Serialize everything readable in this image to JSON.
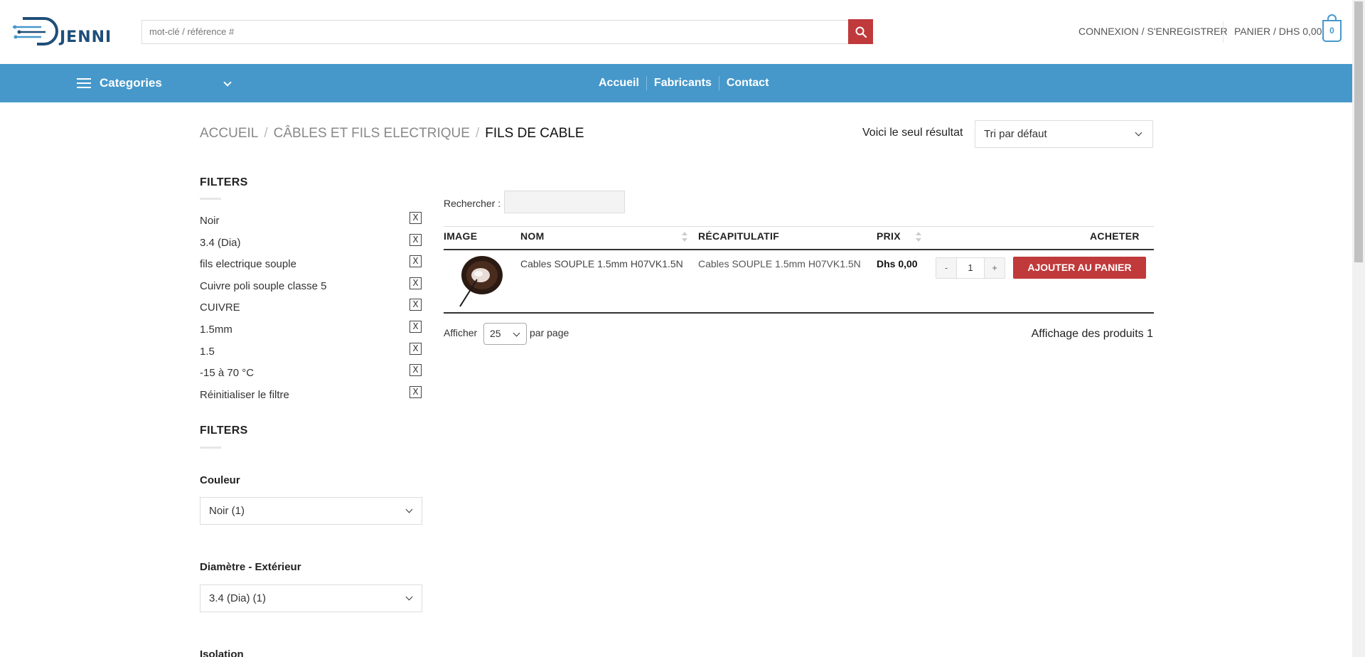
{
  "header": {
    "logo_text": "JENNI",
    "search_placeholder": "mot-clé / référence #",
    "login_label": "CONNEXION / S'ENREGISTRER",
    "cart_label": "PANIER / DHS 0,00",
    "cart_count": "0"
  },
  "nav": {
    "categories_label": "Categories",
    "links": [
      "Accueil",
      "Fabricants",
      "Contact"
    ]
  },
  "breadcrumb": {
    "items": [
      "ACCUEIL",
      "CÂBLES ET FILS ELECTRIQUE",
      "FILS DE CABLE"
    ],
    "separator": "/"
  },
  "results": {
    "count_text": "Voici le seul résultat",
    "sort_value": "Tri par défaut"
  },
  "sidebar": {
    "active_filters_title": "FILTERS",
    "active_filters": [
      "Noir",
      "3.4 (Dia)",
      "fils electrique souple",
      "Cuivre poli souple classe 5",
      "CUIVRE",
      "1.5mm",
      "1.5",
      "-15 à 70 °C",
      "Réinitialiser le filtre"
    ],
    "remove_glyph": "X",
    "filters_title": "FILTERS",
    "attributes": [
      {
        "label": "Couleur",
        "value": "Noir (1)"
      },
      {
        "label": "Diamètre - Extérieur",
        "value": "3.4 (Dia) (1)"
      },
      {
        "label": "Isolation"
      }
    ]
  },
  "table": {
    "search_label": "Rechercher :",
    "headers": {
      "image": "IMAGE",
      "name": "NOM",
      "summary": "RÉCAPITULATIF",
      "price": "PRIX",
      "buy": "ACHETER"
    },
    "rows": [
      {
        "name": "Cables SOUPLE 1.5mm H07VK1.5N",
        "summary": "Cables SOUPLE 1.5mm H07VK1.5N",
        "price": "Dhs 0,00",
        "quantity": "1",
        "add_label": "AJOUTER AU PANIER"
      }
    ],
    "qty_minus": "-",
    "qty_plus": "+",
    "show_label": "Afficher",
    "per_page": "25",
    "per_page_suffix": "par page",
    "showing_text": "Affichage des produits 1"
  },
  "colors": {
    "primary": "#4698cb",
    "accent": "#c0393b"
  }
}
